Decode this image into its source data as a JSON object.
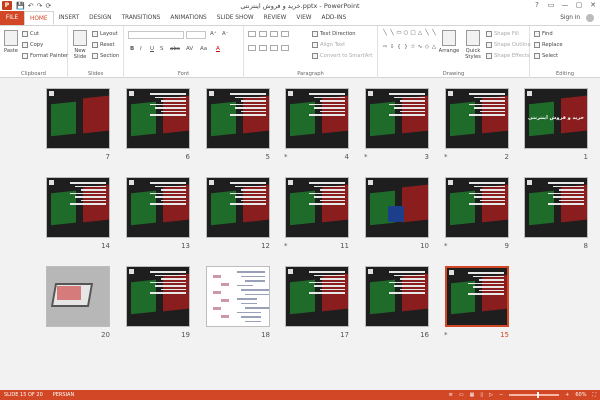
{
  "window": {
    "app_badge": "P",
    "title": "خرید و فروش اینترنتی.pptx - PowerPoint",
    "qat": [
      "💾",
      "↶",
      "↷",
      "⟳"
    ],
    "controls": [
      "?",
      "▭",
      "—",
      "▢",
      "✕"
    ]
  },
  "tabs": {
    "file": "FILE",
    "items": [
      "HOME",
      "INSERT",
      "DESIGN",
      "TRANSITIONS",
      "ANIMATIONS",
      "SLIDE SHOW",
      "REVIEW",
      "VIEW",
      "ADD-INS"
    ],
    "active": "HOME",
    "signin": "Sign in"
  },
  "ribbon": {
    "clipboard": {
      "label": "Clipboard",
      "paste": "Paste",
      "cut": "Cut",
      "copy": "Copy",
      "format_painter": "Format Painter"
    },
    "slides": {
      "label": "Slides",
      "new_slide": "New Slide",
      "layout": "Layout",
      "reset": "Reset",
      "section": "Section"
    },
    "font": {
      "label": "Font",
      "size_up": "A⁺",
      "size_down": "A⁻",
      "bold": "B",
      "italic": "I",
      "underline": "U",
      "shadow": "S",
      "strike": "abc",
      "spacing": "AV",
      "case": "Aa",
      "color": "A"
    },
    "paragraph": {
      "label": "Paragraph",
      "text_direction": "Text Direction",
      "align_text": "Align Text",
      "convert_smartart": "Convert to SmartArt"
    },
    "drawing": {
      "label": "Drawing",
      "arrange": "Arrange",
      "quick_styles": "Quick Styles",
      "shape_fill": "Shape Fill",
      "shape_outline": "Shape Outline",
      "shape_effects": "Shape Effects"
    },
    "editing": {
      "label": "Editing",
      "find": "Find",
      "replace": "Replace",
      "select": "Select"
    }
  },
  "slides": [
    {
      "num": "7",
      "type": "title"
    },
    {
      "num": "6",
      "type": "text"
    },
    {
      "num": "5",
      "type": "text"
    },
    {
      "num": "4",
      "type": "text",
      "star": true
    },
    {
      "num": "3",
      "type": "text",
      "star": true
    },
    {
      "num": "2",
      "type": "text",
      "star": true
    },
    {
      "num": "1",
      "type": "title",
      "title": "خرید و فروش اینترنتی"
    },
    {
      "num": "14",
      "type": "buysell"
    },
    {
      "num": "13",
      "type": "text"
    },
    {
      "num": "12",
      "type": "text"
    },
    {
      "num": "11",
      "type": "text",
      "star": true
    },
    {
      "num": "10",
      "type": "logo"
    },
    {
      "num": "9",
      "type": "text",
      "star": true
    },
    {
      "num": "8",
      "type": "text"
    },
    {
      "num": "20",
      "type": "photo"
    },
    {
      "num": "19",
      "type": "text"
    },
    {
      "num": "18",
      "type": "white"
    },
    {
      "num": "17",
      "type": "text"
    },
    {
      "num": "16",
      "type": "text"
    },
    {
      "num": "15",
      "type": "text",
      "star": true,
      "selected": true
    }
  ],
  "status": {
    "slide_of": "SLIDE 15 OF 20",
    "language": "PERSIAN",
    "zoom": "60%"
  },
  "colors": {
    "accent": "#d24726"
  }
}
